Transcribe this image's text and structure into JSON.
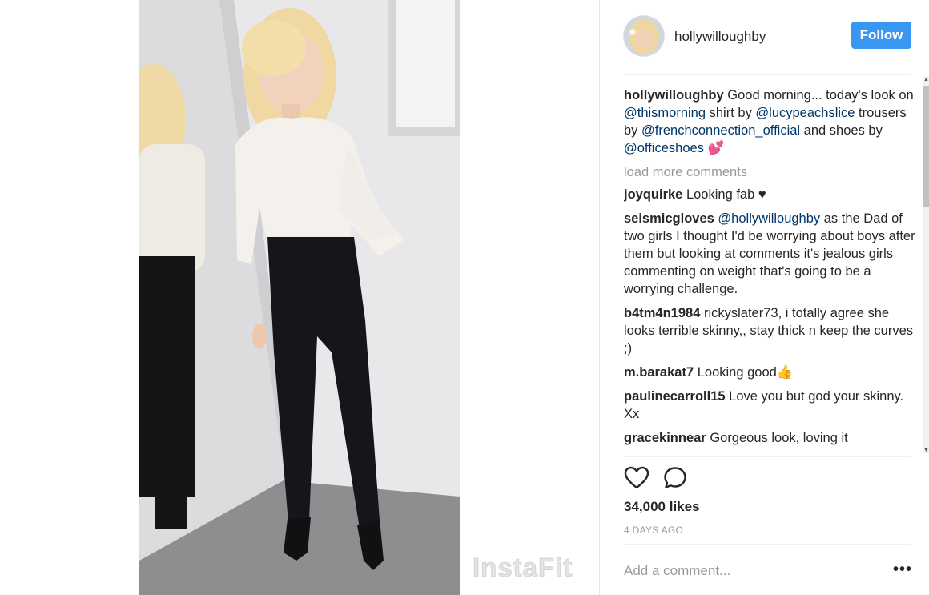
{
  "post": {
    "username": "hollywilloughby",
    "follow_label": "Follow",
    "watermark": "InstaFit"
  },
  "caption": {
    "user": "hollywilloughby",
    "text_1": " Good morning... today's look on ",
    "mention_1": "@thismorning",
    "text_2": " shirt by ",
    "mention_2": "@lucypeachslice",
    "text_3": " trousers by ",
    "mention_3": "@frenchconnection_official",
    "text_4": " and shoes by ",
    "mention_4": "@officeshoes",
    "emoji": "💕"
  },
  "load_more_label": "load more comments",
  "comments": [
    {
      "user": "joyquirke",
      "text": " Looking fab ♥"
    },
    {
      "user": "seismicgloves",
      "mention": "@hollywilloughby",
      "text": " as the Dad of two girls I thought I'd be worrying about boys after them but looking at comments it's jealous girls commenting on weight that's going to be a worrying challenge."
    },
    {
      "user": "b4tm4n1984",
      "text": " rickyslater73, i totally agree she looks terrible skinny,, stay thick n keep the curves ;)"
    },
    {
      "user": "m.barakat7",
      "text": " Looking good👍"
    },
    {
      "user": "paulinecarroll15",
      "text": " Love you but god your skinny. Xx"
    },
    {
      "user": "gracekinnear",
      "text": " Gorgeous look, loving it"
    }
  ],
  "likes_label": "34,000 likes",
  "timestamp": "4 DAYS AGO",
  "comment_input": {
    "placeholder": "Add a comment..."
  },
  "more_options_label": "•••",
  "icons": {
    "like": "heart-outline-icon",
    "comment": "speech-bubble-icon"
  },
  "colors": {
    "follow": "#3897f0",
    "mention": "#003569",
    "muted": "#999999"
  }
}
